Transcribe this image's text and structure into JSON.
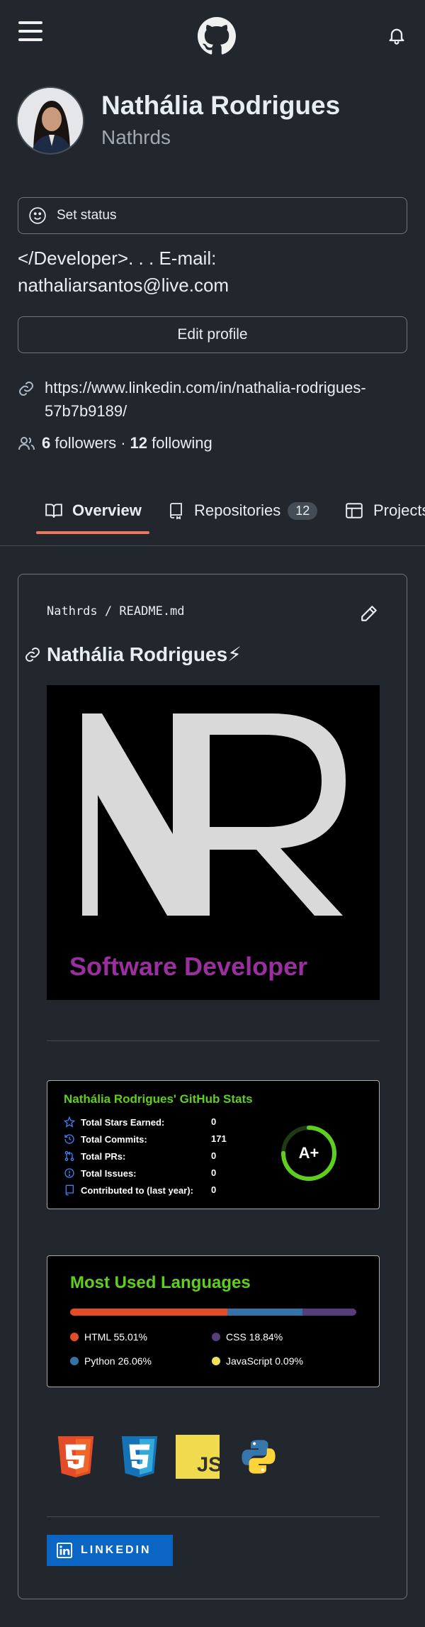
{
  "profile": {
    "name": "Nathália Rodrigues",
    "login": "Nathrds",
    "status_label": "Set status",
    "bio": "</Developer>. . . E-mail: nathaliarsantos@live.com",
    "edit_label": "Edit profile",
    "website": "https://www.linkedin.com/in/nathalia-rodrigues-57b7b9189/",
    "followers_count": "6",
    "followers_label": "followers",
    "separator": "·",
    "following_count": "12",
    "following_label": "following"
  },
  "tabs": [
    {
      "label": "Overview",
      "icon": "book-icon",
      "active": true
    },
    {
      "label": "Repositories",
      "icon": "repo-icon",
      "count": "12"
    },
    {
      "label": "Projects",
      "icon": "table-icon"
    }
  ],
  "readme": {
    "path_user": "Nathrds",
    "path_sep": "/",
    "path_file": "README.md",
    "heading": "Nathália Rodrigues⚡",
    "banner": {
      "letters": "NR",
      "subtitle": "Software Developer"
    }
  },
  "stats_card": {
    "title": "Nathália Rodrigues' GitHub Stats",
    "rows": [
      {
        "label": "Total Stars Earned:",
        "value": "0",
        "icon": "star-icon"
      },
      {
        "label": "Total Commits:",
        "value": "171",
        "icon": "history-icon"
      },
      {
        "label": "Total PRs:",
        "value": "0",
        "icon": "pr-icon"
      },
      {
        "label": "Total Issues:",
        "value": "0",
        "icon": "issue-icon"
      },
      {
        "label": "Contributed to (last year):",
        "value": "0",
        "icon": "repo-icon"
      }
    ],
    "grade": "A+",
    "grade_progress": 0.75
  },
  "languages_card": {
    "title": "Most Used Languages",
    "languages": [
      {
        "label": "HTML 55.01%",
        "percent": 55.01,
        "color": "#e34c26"
      },
      {
        "label": "CSS 18.84%",
        "percent": 18.84,
        "color": "#563d7c"
      },
      {
        "label": "Python 26.06%",
        "percent": 26.06,
        "color": "#3572A5"
      },
      {
        "label": "JavaScript 0.09%",
        "percent": 0.09,
        "color": "#f1e05a"
      }
    ]
  },
  "tech_icons": [
    "html5-icon",
    "css3-icon",
    "javascript-icon",
    "python-icon"
  ],
  "linkedin_badge": {
    "label": "LINKEDIN",
    "color": "#0a66c2"
  },
  "colors": {
    "background": "#22272e",
    "accent": "#ec775c",
    "stats_green": "#5fcf1f"
  }
}
